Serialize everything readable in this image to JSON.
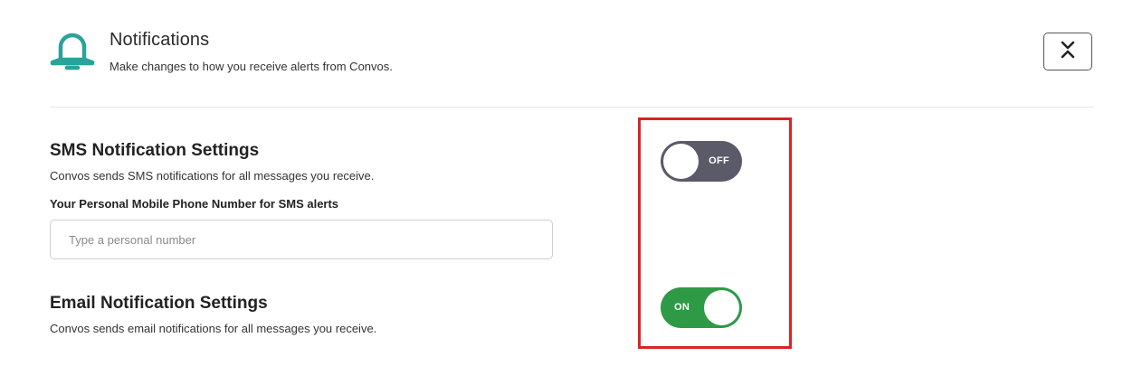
{
  "header": {
    "title": "Notifications",
    "subtitle": "Make changes to how you receive alerts from Convos.",
    "icon": "bell-icon",
    "collapse_icon": "collapse-chevrons-icon",
    "accent_color": "#2aa39a"
  },
  "sms": {
    "title": "SMS Notification Settings",
    "description": "Convos sends SMS notifications for all messages you receive.",
    "phone_label": "Your Personal Mobile Phone Number for SMS alerts",
    "phone_value": "",
    "phone_placeholder": "Type a personal number",
    "toggle_state": "OFF",
    "toggle_color": "#5b5a69"
  },
  "email": {
    "title": "Email Notification Settings",
    "description": "Convos sends email notifications for all messages you receive.",
    "toggle_state": "ON",
    "toggle_color": "#2e9a45"
  },
  "highlight_color": "#d92424"
}
